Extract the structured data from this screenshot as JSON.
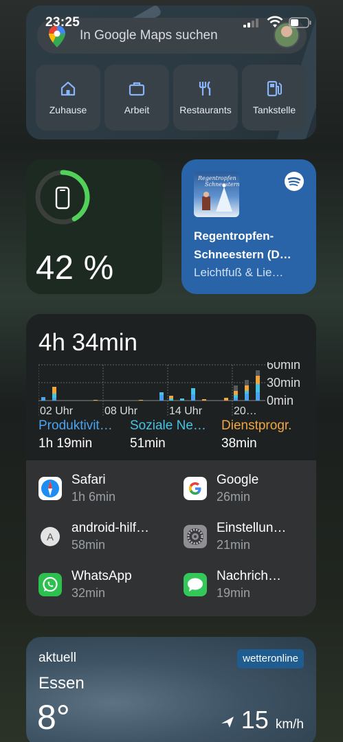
{
  "status_bar": {
    "time": "23:25"
  },
  "maps": {
    "search_placeholder": "In Google Maps suchen",
    "shortcuts": [
      {
        "label": "Zuhause",
        "icon": "home-icon"
      },
      {
        "label": "Arbeit",
        "icon": "briefcase-icon"
      },
      {
        "label": "Restaurants",
        "icon": "fork-knife-icon"
      },
      {
        "label": "Tankstelle",
        "icon": "fuel-icon"
      }
    ]
  },
  "battery": {
    "percent_label": "42 %",
    "level": 0.42,
    "ring_color": "#52d15a"
  },
  "spotify": {
    "title_line1": "Regentropfen-",
    "title_line2": "Schneestern (D…",
    "artist": "Leichtfuß & Lie…",
    "cover_text_top": "Regentropfen",
    "cover_text_bottom": "Schneestern",
    "accent": "#2a64a8"
  },
  "screentime": {
    "total": "4h 34min",
    "chart": {
      "y_labels": [
        "60min",
        "30min",
        "0min"
      ],
      "x_labels": [
        "02 Uhr",
        "08 Uhr",
        "14 Uhr",
        "20…"
      ]
    },
    "categories": [
      {
        "name": "Produktivit…",
        "duration": "1h 19min",
        "color": "#4aa3f0"
      },
      {
        "name": "Soziale Ne…",
        "duration": "51min",
        "color": "#45c3e3"
      },
      {
        "name": "Dienstprogr.",
        "duration": "38min",
        "color": "#f0a640"
      }
    ],
    "apps": [
      {
        "name": "Safari",
        "time": "1h 6min",
        "icon": "safari-icon"
      },
      {
        "name": "Google",
        "time": "26min",
        "icon": "google-icon"
      },
      {
        "name": "android-hilf…",
        "time": "58min",
        "icon": "android-letter-icon",
        "letter": "A"
      },
      {
        "name": "Einstellun…",
        "time": "21min",
        "icon": "settings-icon"
      },
      {
        "name": "WhatsApp",
        "time": "32min",
        "icon": "whatsapp-icon"
      },
      {
        "name": "Nachrich…",
        "time": "19min",
        "icon": "messages-icon"
      }
    ]
  },
  "weather": {
    "label_now": "aktuell",
    "city": "Essen",
    "temperature": "8°",
    "brand": "wetteronline",
    "wind_speed": "15",
    "wind_unit": "km/h"
  }
}
